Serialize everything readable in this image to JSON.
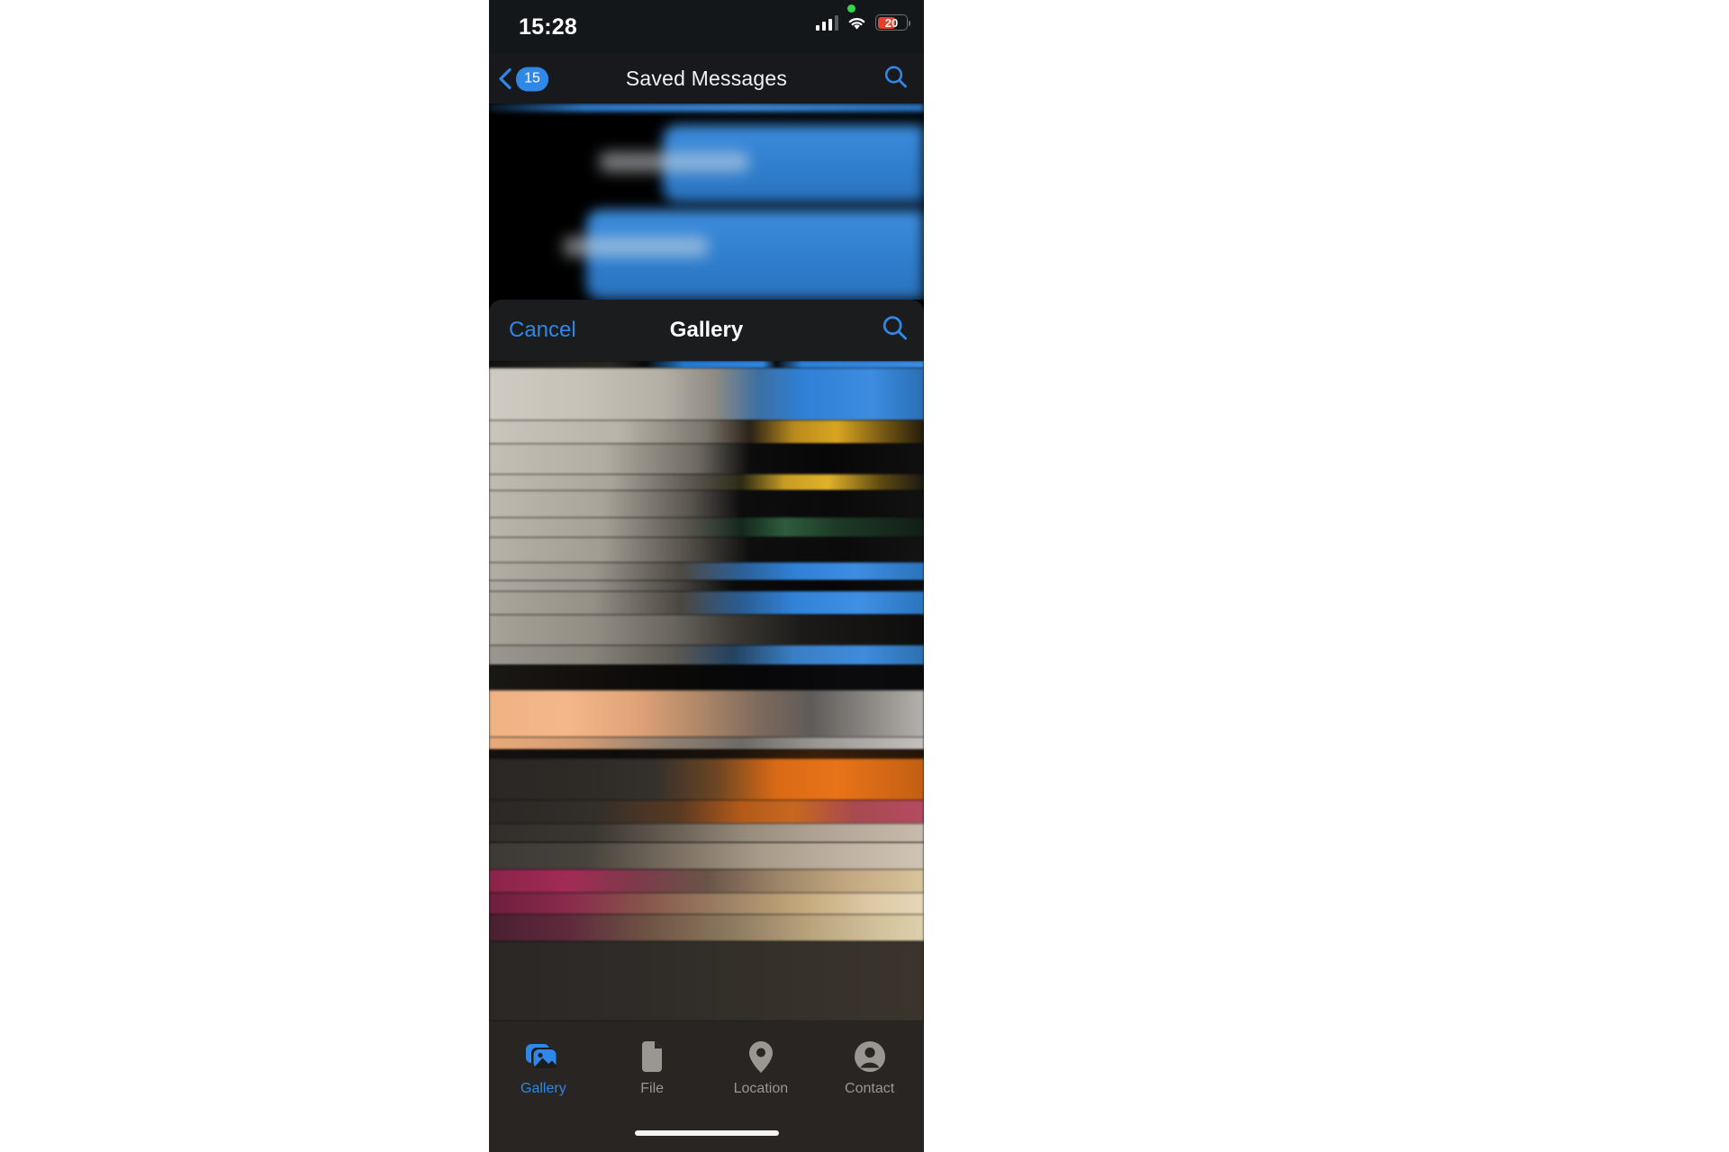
{
  "status_bar": {
    "time": "15:28",
    "battery_level": "20",
    "battery_percent": 20,
    "signal_icon": "cellular-signal-icon",
    "wifi_icon": "wifi-icon",
    "recording_indicator_icon": "green-status-dot-icon"
  },
  "chat_nav": {
    "back_icon": "chevron-left-icon",
    "unread_badge": "15",
    "title": "Saved Messages",
    "search_icon": "search-icon"
  },
  "chat": {
    "messages": [
      {
        "direction": "outgoing",
        "redacted": true
      },
      {
        "direction": "outgoing",
        "redacted": true
      }
    ]
  },
  "attachment_sheet": {
    "cancel_label": "Cancel",
    "title": "Gallery",
    "search_icon": "search-icon"
  },
  "tab_bar": {
    "active_index": 0,
    "tabs": [
      {
        "label": "Gallery",
        "icon": "photos-stack-icon",
        "active": true
      },
      {
        "label": "File",
        "icon": "document-icon",
        "active": false
      },
      {
        "label": "Location",
        "icon": "map-pin-icon",
        "active": false
      },
      {
        "label": "Contact",
        "icon": "person-circle-icon",
        "active": false
      }
    ]
  },
  "home_indicator": {
    "visible": true
  },
  "colors": {
    "accent_blue": "#2f87e8",
    "bubble_blue": "#3d8ddd",
    "battery_red": "#e8402a",
    "status_green": "#32d74b",
    "nav_background": "#17191c",
    "sheet_background": "#1b1c1e",
    "tabbar_background": "#282522",
    "tab_inactive": "#9a9792"
  }
}
